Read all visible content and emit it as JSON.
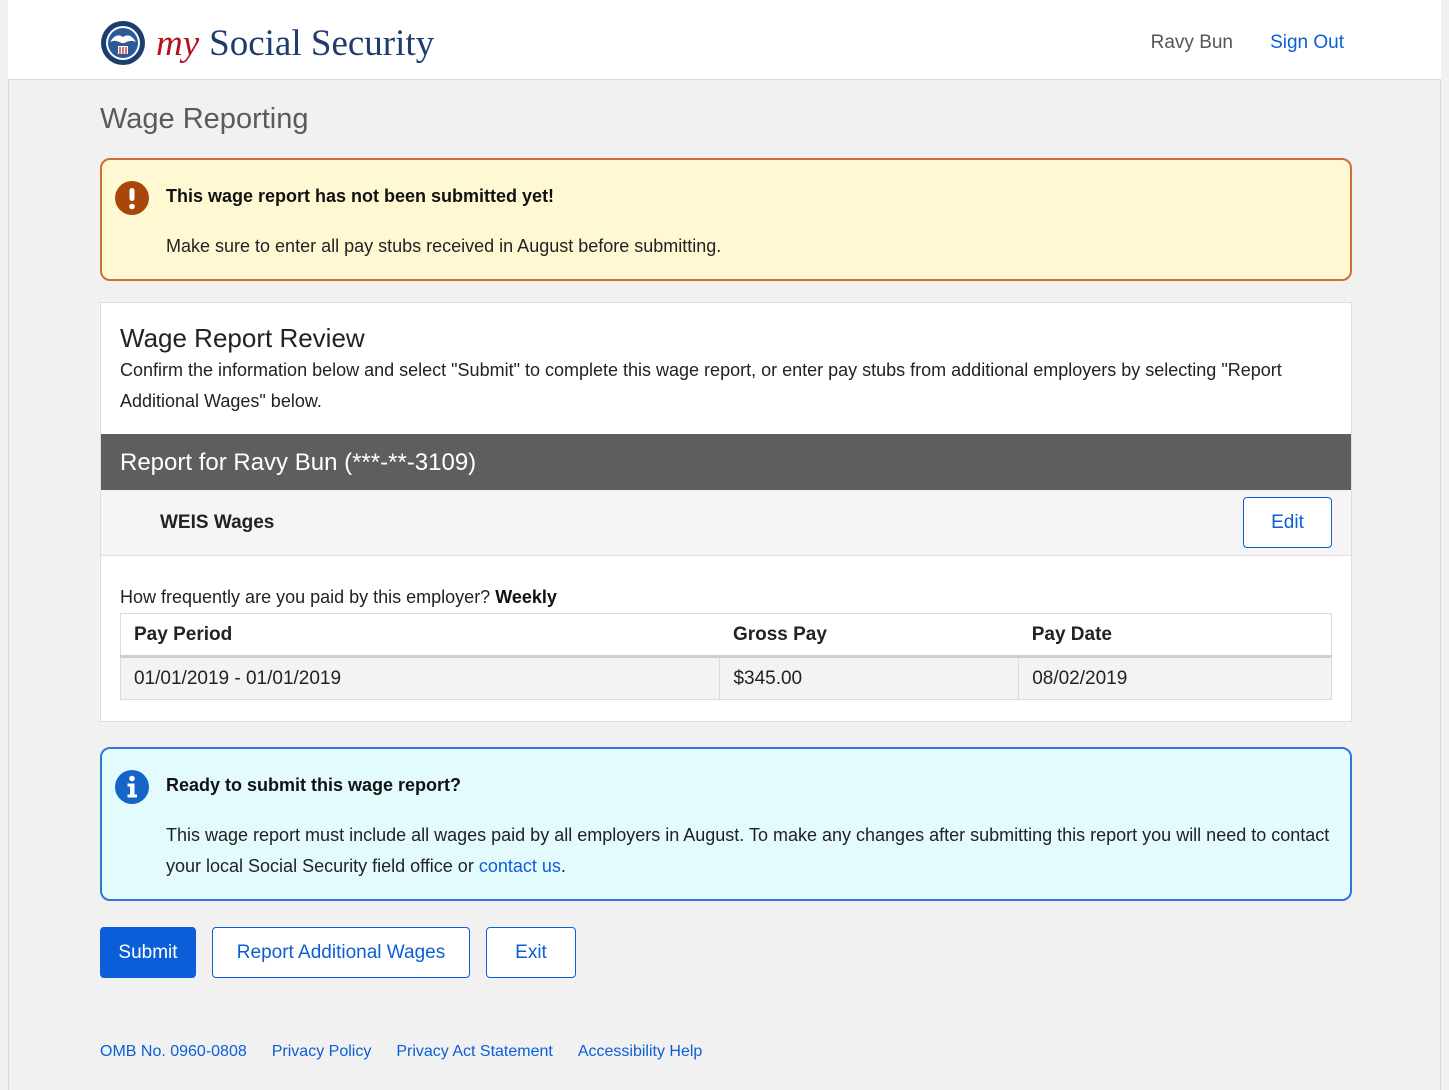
{
  "header": {
    "brand_my": "my",
    "brand_name": "Social Security",
    "user_name": "Ravy Bun",
    "sign_out": "Sign Out",
    "logo_icon": "ssa-seal-icon"
  },
  "page_title": "Wage Reporting",
  "warning_alert": {
    "icon": "exclamation-circle-icon",
    "title": "This wage report has not been submitted yet!",
    "body": "Make sure to enter all pay stubs received in August before submitting."
  },
  "review": {
    "title": "Wage Report Review",
    "description": "Confirm the information below and select \"Submit\" to complete this wage report, or enter pay stubs from additional employers by selecting \"Report Additional Wages\" below.",
    "report_header": "Report for Ravy Bun (***-**-3109)",
    "employer_name": "WEIS Wages",
    "edit_label": "Edit",
    "frequency_question": "How frequently are you paid by this employer?",
    "frequency_value": "Weekly",
    "table": {
      "headers": [
        "Pay Period",
        "Gross Pay",
        "Pay Date"
      ],
      "rows": [
        [
          "01/01/2019 - 01/01/2019",
          "$345.00",
          "08/02/2019"
        ]
      ]
    }
  },
  "info_alert": {
    "icon": "info-circle-icon",
    "title": "Ready to submit this wage report?",
    "body": "This wage report must include all wages paid by all employers in August. To make any changes after submitting this report you will need to contact your local Social Security field office or ",
    "link": "contact us",
    "body_end": "."
  },
  "actions": {
    "submit": "Submit",
    "report_additional": "Report Additional Wages",
    "exit": "Exit"
  },
  "footer": {
    "links": [
      "OMB No. 0960-0808",
      "Privacy Policy",
      "Privacy Act Statement",
      "Accessibility Help"
    ]
  },
  "colors": {
    "primary": "#0b5ed7",
    "warning_border": "#cd6f33",
    "warning_bg": "#fff9d3",
    "info_border": "#2e79d6",
    "info_bg": "#e3fbfd",
    "report_bar": "#5e5e5e",
    "brand_red": "#b3121d",
    "brand_navy": "#1c3d6e"
  }
}
